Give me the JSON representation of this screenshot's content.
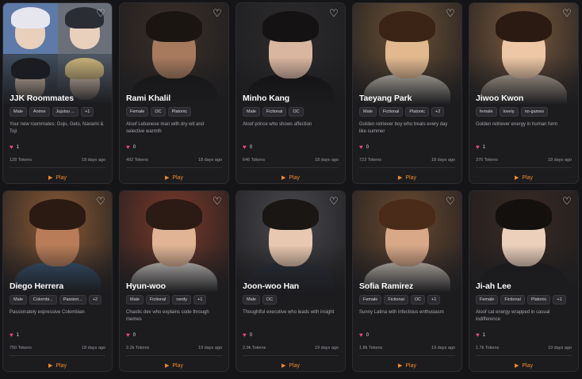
{
  "cards": [
    {
      "name": "JJK Roommates",
      "tags": [
        "Male",
        "Anime",
        "Jujutsu ...",
        "+1"
      ],
      "desc": "Your new roommates: Gojo, Geto, Nanami & Toji",
      "likes": "1",
      "tokens": "128 Tokens",
      "age": "18 days ago",
      "play": "Play",
      "art": {
        "bg": "#3d4350",
        "skin": "#e6cbb4",
        "hair": "#f1f1f1",
        "top": "#23252b"
      }
    },
    {
      "name": "Rami Khalil",
      "tags": [
        "Female",
        "OC",
        "Platonic"
      ],
      "desc": "Aloof Lebanese man with dry wit and selective warmth",
      "likes": "0",
      "tokens": "492 Tokens",
      "age": "18 days ago",
      "play": "Play",
      "art": {
        "bg": "#3a2f28",
        "skin": "#a77a5e",
        "hair": "#1b1512",
        "top": "#141414"
      }
    },
    {
      "name": "Minho Kang",
      "tags": [
        "Male",
        "Fictional",
        "OC"
      ],
      "desc": "Aloof prince who shows affection",
      "likes": "0",
      "tokens": "646 Tokens",
      "age": "18 days ago",
      "play": "Play",
      "art": {
        "bg": "#2d2b2c",
        "skin": "#d9b6a0",
        "hair": "#141212",
        "top": "#0f0f10"
      }
    },
    {
      "name": "Taeyang Park",
      "tags": [
        "Male",
        "Fictional",
        "Platonic",
        "+2"
      ],
      "desc": "Golden retriever boy who treats every day like summer",
      "likes": "0",
      "tokens": "723 Tokens",
      "age": "18 days ago",
      "play": "Play",
      "art": {
        "bg": "#6b5136",
        "skin": "#e2b98f",
        "hair": "#3b2415",
        "top": "#d8d2c4"
      }
    },
    {
      "name": "Jiwoo Kwon",
      "tags": [
        "female",
        "lovely",
        "no-games"
      ],
      "desc": "Golden retriever energy in human form",
      "likes": "1",
      "tokens": "376 Tokens",
      "age": "18 days ago",
      "play": "Play",
      "art": {
        "bg": "#7a5a3e",
        "skin": "#edc7a6",
        "hair": "#2a1a12",
        "top": "#c8b9a8"
      }
    },
    {
      "name": "Diego Herrera",
      "tags": [
        "Male",
        "Colombi...",
        "Passion...",
        "+2"
      ],
      "desc": "Passionately expressive Colombian",
      "likes": "1",
      "tokens": "750 Tokens",
      "age": "18 days ago",
      "play": "Play",
      "art": {
        "bg": "#8a5a36",
        "skin": "#b87c58",
        "hair": "#2a1a12",
        "top": "#3a5a7a"
      }
    },
    {
      "name": "Hyun-woo",
      "tags": [
        "Male",
        "Fictional",
        "nerdy",
        "+1"
      ],
      "desc": "Chaotic dev who explains code through memes",
      "likes": "0",
      "tokens": "2.2k Tokens",
      "age": "19 days ago",
      "play": "Play",
      "art": {
        "bg": "#7a3a2a",
        "skin": "#e0b494",
        "hair": "#2c1a14",
        "top": "#e6e2dc"
      }
    },
    {
      "name": "Joon-woo Han",
      "tags": [
        "Male",
        "OC"
      ],
      "desc": "Thoughtful executive who leads with insight",
      "likes": "0",
      "tokens": "2.9k Tokens",
      "age": "19 days ago",
      "play": "Play",
      "art": {
        "bg": "#4a4a4e",
        "skin": "#e8c8b0",
        "hair": "#1a1614",
        "top": "#2a2f3a"
      }
    },
    {
      "name": "Sofia Ramirez",
      "tags": [
        "Female",
        "Fictional",
        "OC",
        "+1"
      ],
      "desc": "Sunny Latina with infectious enthusiasm",
      "likes": "0",
      "tokens": "1.8k Tokens",
      "age": "19 days ago",
      "play": "Play",
      "art": {
        "bg": "#6a4a30",
        "skin": "#d8a888",
        "hair": "#4a2a18",
        "top": "#e4dcd0"
      }
    },
    {
      "name": "Ji-ah Lee",
      "tags": [
        "Female",
        "Fictional",
        "Platonic",
        "+1"
      ],
      "desc": "Aloof cat energy wrapped in casual indifference",
      "likes": "1",
      "tokens": "1.7k Tokens",
      "age": "19 days ago",
      "play": "Play",
      "art": {
        "bg": "#3a2a22",
        "skin": "#ecd0bc",
        "hair": "#14100e",
        "top": "#1a1a1c"
      }
    }
  ]
}
